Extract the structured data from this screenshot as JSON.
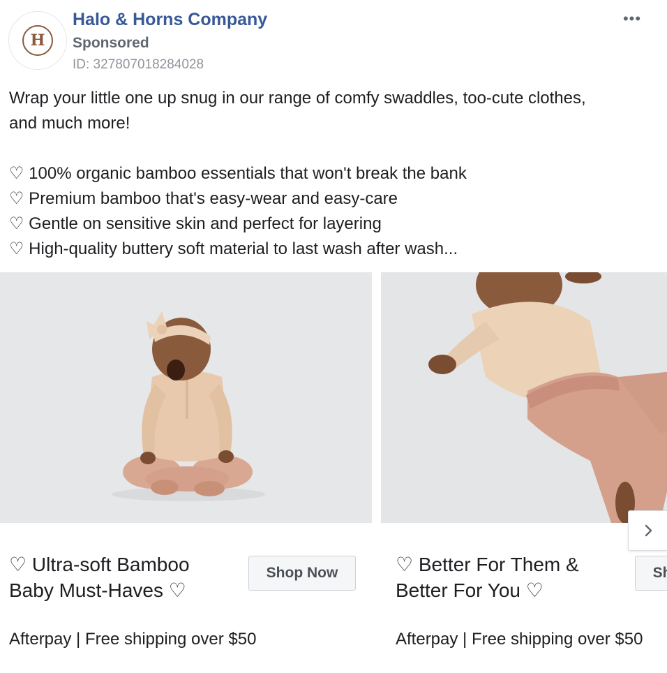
{
  "post": {
    "page_name": "Halo & Horns Company",
    "sponsored_label": "Sponsored",
    "ad_id": "ID: 327807018284028",
    "avatar_letter": "H",
    "more_options": "•••"
  },
  "body": {
    "intro_line1": "Wrap your little one up snug in our range of comfy swaddles, too-cute clothes,",
    "intro_line2": "and much more!",
    "bullets": [
      "♡ 100% organic bamboo essentials that won't break the bank",
      "♡ Premium bamboo that's easy-wear and easy-care",
      "♡ Gentle on sensitive skin and perfect for layering",
      "♡ High-quality buttery soft material to last wash after wash..."
    ]
  },
  "carousel": {
    "cards": [
      {
        "title_line1": "♡ Ultra-soft Bamboo",
        "title_line2": "Baby Must-Haves ♡",
        "cta": "Shop Now",
        "description": "Afterpay | Free shipping over $50"
      },
      {
        "title_line1": "♡ Better For Them &",
        "title_line2": "Better For You ♡",
        "cta": "Shop Now",
        "description": "Afterpay | Free shipping over $50"
      }
    ]
  },
  "colors": {
    "page_name": "#385898",
    "secondary_text": "#616770",
    "photo_background": "#e6e7e9",
    "outfit": "#e8c9ad",
    "pants": "#d4a08c"
  },
  "icons": {
    "more": "more-options-icon",
    "next": "chevron-right-icon"
  }
}
